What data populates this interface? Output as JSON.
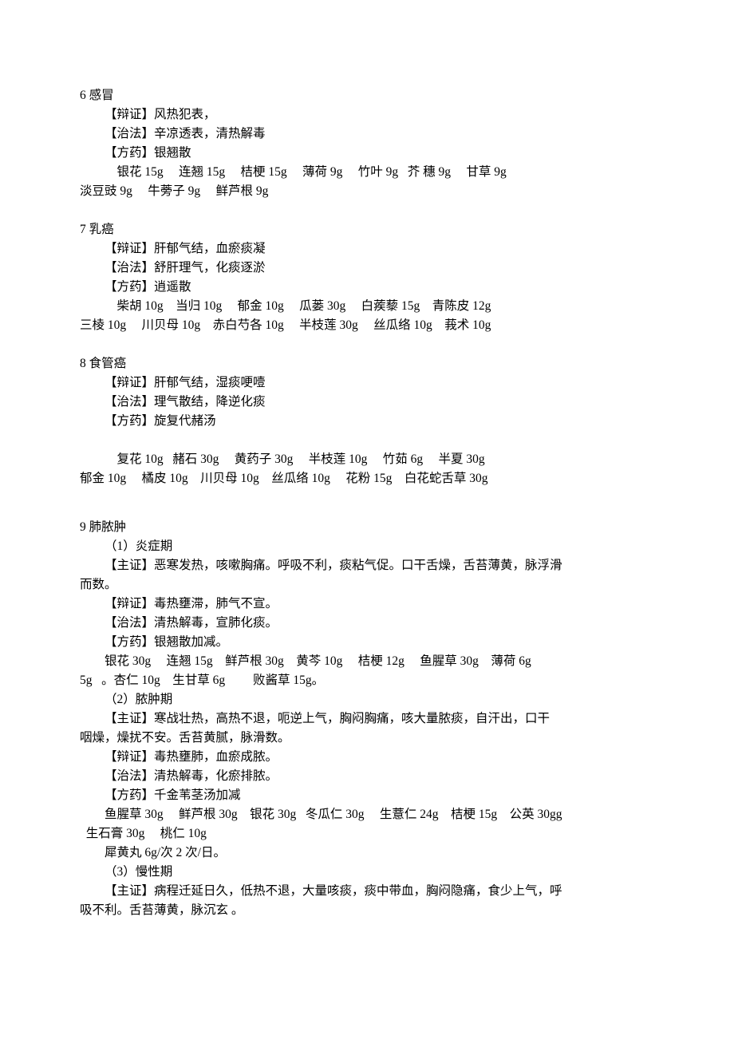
{
  "s6": {
    "title": "6 感冒",
    "bianzh": "【辩证】风热犯表，",
    "zhifa": "【治法】辛凉透表，清热解毒",
    "fangyao": "【方药】银翘散",
    "ing1": "银花 15g     连翘 15g     桔梗 15g     薄荷 9g     竹叶 9g   芥 穗 9g     甘草 9g",
    "ing2": "淡豆豉 9g     牛蒡子 9g     鲜芦根 9g"
  },
  "s7": {
    "title": "7 乳癌",
    "bianzh": "【辩证】肝郁气结，血瘀痰凝",
    "zhifa": "【治法】舒肝理气，化痰逐淤",
    "fangyao": "【方药】逍遥散",
    "ing1": "柴胡 10g    当归 10g     郁金 10g     瓜蒌 30g     白蒺藜 15g    青陈皮 12g",
    "ing2": "三棱 10g     川贝母 10g    赤白芍各 10g     半枝莲 30g     丝瓜络 10g    莪术 10g"
  },
  "s8": {
    "title": "8 食管癌",
    "bianzh": "【辩证】肝郁气结，湿痰哽噎",
    "zhifa": "【治法】理气散结，降逆化痰",
    "fangyao": "【方药】旋复代赭汤",
    "ing1": "复花 10g   赭石 30g     黄药子 30g     半枝莲 10g     竹茹 6g     半夏 30g",
    "ing2": "郁金 10g     橘皮 10g    川贝母 10g    丝瓜络 10g     花粉 15g    白花蛇舌草 30g"
  },
  "s9": {
    "title": " 9 肺脓肿",
    "p1_label": "（1）炎症期",
    "p1_zhuzh": "【主证】恶寒发热，咳嗽胸痛。呼吸不利，痰粘气促。口干舌燥，舌苔薄黄，脉浮滑",
    "p1_zhuzh2": "而数。",
    "p1_bianzh": "【辩证】毒热壅滞，肺气不宣。",
    "p1_zhifa": "【治法】清热解毒，宣肺化痰。",
    "p1_fangyao": "【方药】银翘散加减。",
    "p1_ing1": "银花 30g     连翘 15g    鲜芦根 30g    黄芩 10g     桔梗 12g     鱼腥草 30g    薄荷 6g",
    "p1_ing2": "5g   。杏仁 10g    生甘草 6g         败酱草 15g。",
    "p2_label": "（2）脓肿期",
    "p2_zhuzh": "【主证】寒战壮热，高热不退，呃逆上气，胸闷胸痛，咳大量脓痰，自汗出，口干",
    "p2_zhuzh2": "咽燥，燥扰不安。舌苔黄腻，脉滑数。",
    "p2_bianzh": "【辩证】毒热壅肺，血瘀成脓。",
    "p2_zhifa": "【治法】清热解毒，化瘀排脓。",
    "p2_fangyao": "【方药】千金苇茎汤加减",
    "p2_ing1": "鱼腥草 30g     鲜芦根 30g    银花 30g   冬瓜仁 30g     生薏仁 24g    桔梗 15g    公英 30gg",
    "p2_ing2": "  生石膏 30g     桃仁 10g",
    "p2_extra": "犀黄丸   6g/次   2 次/日。",
    "p3_label": "（3）慢性期",
    "p3_zhuzh": "【主证】病程迁延日久，低热不退，大量咳痰，痰中带血，胸闷隐痛，食少上气，呼",
    "p3_zhuzh2": "吸不利。舌苔薄黄，脉沉玄  。"
  }
}
